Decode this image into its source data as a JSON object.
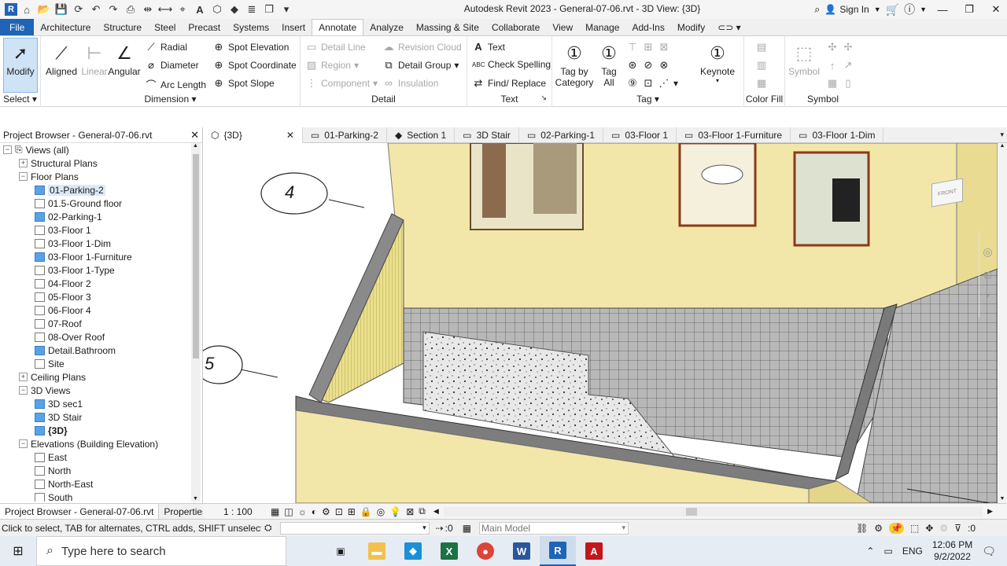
{
  "window": {
    "title": "Autodesk Revit 2023 - General-07-06.rvt - 3D View: {3D}",
    "sign_in": "Sign In"
  },
  "ribbon_tabs": [
    "File",
    "Architecture",
    "Structure",
    "Steel",
    "Precast",
    "Systems",
    "Insert",
    "Annotate",
    "Analyze",
    "Massing & Site",
    "Collaborate",
    "View",
    "Manage",
    "Add-Ins",
    "Modify"
  ],
  "active_tab": "Annotate",
  "ribbon": {
    "select": {
      "modify": "Modify",
      "label": "Select"
    },
    "dimension": {
      "label": "Dimension",
      "aligned": "Aligned",
      "linear": "Linear",
      "angular": "Angular",
      "radial": "Radial",
      "diameter": "Diameter",
      "arc_length": "Arc Length",
      "spot_elevation": "Spot Elevation",
      "spot_coordinate": "Spot Coordinate",
      "spot_slope": "Spot Slope"
    },
    "detail": {
      "label": "Detail",
      "detail_line": "Detail Line",
      "region": "Region",
      "component": "Component",
      "revision_cloud": "Revision Cloud",
      "detail_group": "Detail Group",
      "insulation": "Insulation"
    },
    "text": {
      "label": "Text",
      "text": "Text",
      "check_spelling": "Check Spelling",
      "find_replace": "Find/ Replace"
    },
    "tag": {
      "label": "Tag",
      "tag_by_category_1": "Tag by",
      "tag_by_category_2": "Category",
      "tag_all_1": "Tag",
      "tag_all_2": "All",
      "keynote": "Keynote"
    },
    "color_fill": {
      "label": "Color Fill"
    },
    "symbol": {
      "label": "Symbol",
      "symbol": "Symbol"
    }
  },
  "project_browser": {
    "title": "Project Browser - General-07-06.rvt",
    "items": [
      {
        "label": "Views (all)",
        "level": 0,
        "toggle": "−",
        "icon": "views"
      },
      {
        "label": "Structural Plans",
        "level": 1,
        "toggle": "+"
      },
      {
        "label": "Floor Plans",
        "level": 1,
        "toggle": "−"
      },
      {
        "label": "01-Parking-2",
        "level": 2,
        "icon": "blue",
        "selected": true
      },
      {
        "label": "01.5-Ground floor",
        "level": 2,
        "icon": "white"
      },
      {
        "label": "02-Parking-1",
        "level": 2,
        "icon": "blue"
      },
      {
        "label": "03-Floor 1",
        "level": 2,
        "icon": "white"
      },
      {
        "label": "03-Floor 1-Dim",
        "level": 2,
        "icon": "white"
      },
      {
        "label": "03-Floor 1-Furniture",
        "level": 2,
        "icon": "blue"
      },
      {
        "label": "03-Floor 1-Type",
        "level": 2,
        "icon": "white"
      },
      {
        "label": "04-Floor 2",
        "level": 2,
        "icon": "white"
      },
      {
        "label": "05-Floor 3",
        "level": 2,
        "icon": "white"
      },
      {
        "label": "06-Floor 4",
        "level": 2,
        "icon": "white"
      },
      {
        "label": "07-Roof",
        "level": 2,
        "icon": "white"
      },
      {
        "label": "08-Over Roof",
        "level": 2,
        "icon": "white"
      },
      {
        "label": "Detail.Bathroom",
        "level": 2,
        "icon": "blue"
      },
      {
        "label": "Site",
        "level": 2,
        "icon": "white"
      },
      {
        "label": "Ceiling Plans",
        "level": 1,
        "toggle": "+"
      },
      {
        "label": "3D Views",
        "level": 1,
        "toggle": "−"
      },
      {
        "label": "3D sec1",
        "level": 2,
        "icon": "blue"
      },
      {
        "label": "3D Stair",
        "level": 2,
        "icon": "blue"
      },
      {
        "label": "{3D}",
        "level": 2,
        "icon": "blue",
        "bold": true
      },
      {
        "label": "Elevations (Building Elevation)",
        "level": 1,
        "toggle": "−"
      },
      {
        "label": "East",
        "level": 2,
        "icon": "white"
      },
      {
        "label": "North",
        "level": 2,
        "icon": "white"
      },
      {
        "label": "North-East",
        "level": 2,
        "icon": "white"
      },
      {
        "label": "South",
        "level": 2,
        "icon": "white"
      }
    ],
    "footer_tabs": [
      "Project Browser - General-07-06.rvt",
      "Properties"
    ]
  },
  "view_tabs": [
    "{3D}",
    "01-Parking-2",
    "Section 1",
    "3D Stair",
    "02-Parking-1",
    "03-Floor 1",
    "03-Floor 1-Furniture",
    "03-Floor 1-Dim"
  ],
  "view": {
    "grid_bubble_1": "4",
    "grid_bubble_2": "5",
    "viewcube_label": "FRONT",
    "scale": "1 : 100"
  },
  "status": {
    "hint": "Click to select, TAB for alternates, CTRL adds, SHIFT unselects.",
    "selection_count": ":0",
    "model": "Main Model",
    "filter_count": ":0"
  },
  "taskbar": {
    "search_placeholder": "Type here to search",
    "language": "ENG",
    "time": "12:06 PM",
    "date": "9/2/2022"
  },
  "colors": {
    "file_tab": "#1f64b5",
    "wall": "#f1e7a6",
    "tile": "#b9b9b9"
  }
}
